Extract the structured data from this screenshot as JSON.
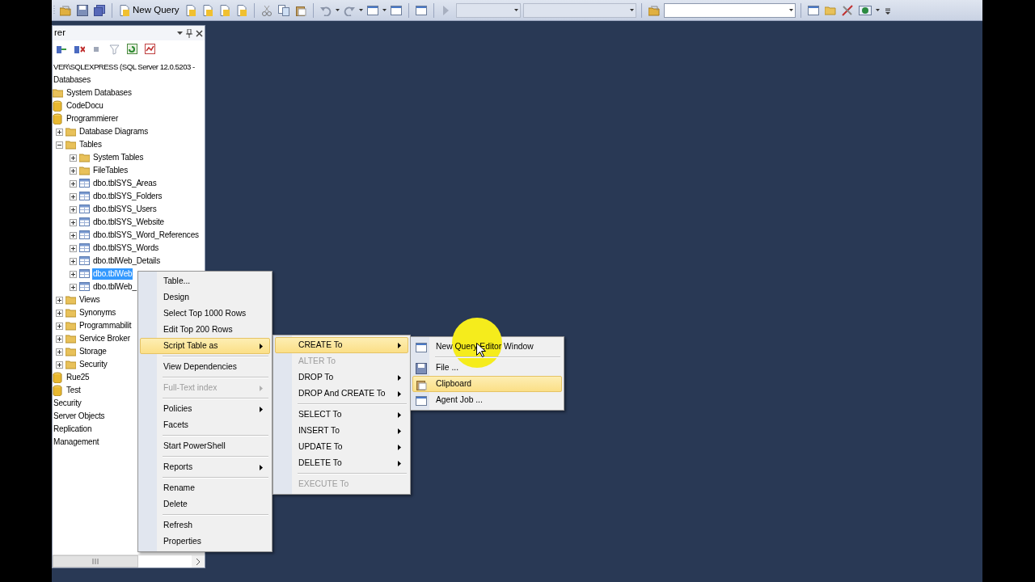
{
  "toolbar": {
    "new_query": "New Query"
  },
  "object_explorer": {
    "title": "rer",
    "tree": [
      {
        "label": "VER\\SQLEXPRESS (SQL Server 12.0.5203 -",
        "selected": false,
        "children": [
          {
            "label": "Databases",
            "selected": false,
            "children": [
              {
                "label": "System Databases",
                "kind": "folder",
                "selected": false
              },
              {
                "label": "CodeDocu",
                "kind": "database",
                "selected": false
              },
              {
                "label": "Programmierer",
                "kind": "database",
                "selected": false,
                "children": [
                  {
                    "label": "Database Diagrams",
                    "kind": "folder",
                    "selected": false,
                    "expanded": false
                  },
                  {
                    "label": "Tables",
                    "kind": "folder",
                    "selected": false,
                    "expanded": true,
                    "children": [
                      {
                        "label": "System Tables",
                        "kind": "folder",
                        "selected": false,
                        "expanded": false
                      },
                      {
                        "label": "FileTables",
                        "kind": "folder",
                        "selected": false,
                        "expanded": false
                      },
                      {
                        "label": "dbo.tblSYS_Areas",
                        "kind": "table",
                        "selected": false,
                        "expanded": false
                      },
                      {
                        "label": "dbo.tblSYS_Folders",
                        "kind": "table",
                        "selected": false,
                        "expanded": false
                      },
                      {
                        "label": "dbo.tblSYS_Users",
                        "kind": "table",
                        "selected": false,
                        "expanded": false
                      },
                      {
                        "label": "dbo.tblSYS_Website",
                        "kind": "table",
                        "selected": false,
                        "expanded": false
                      },
                      {
                        "label": "dbo.tblSYS_Word_References",
                        "kind": "table",
                        "selected": false,
                        "expanded": false
                      },
                      {
                        "label": "dbo.tblSYS_Words",
                        "kind": "table",
                        "selected": false,
                        "expanded": false
                      },
                      {
                        "label": "dbo.tblWeb_Details",
                        "kind": "table",
                        "selected": false,
                        "expanded": false
                      },
                      {
                        "label": "dbo.tblWeb",
                        "kind": "table",
                        "selected": true,
                        "expanded": false
                      },
                      {
                        "label": "dbo.tblWeb_",
                        "kind": "table",
                        "selected": false,
                        "expanded": false
                      }
                    ]
                  },
                  {
                    "label": "Views",
                    "kind": "folder",
                    "selected": false,
                    "expanded": false
                  },
                  {
                    "label": "Synonyms",
                    "kind": "folder",
                    "selected": false,
                    "expanded": false
                  },
                  {
                    "label": "Programmabilit",
                    "kind": "folder",
                    "selected": false,
                    "expanded": false
                  },
                  {
                    "label": "Service Broker",
                    "kind": "folder",
                    "selected": false,
                    "expanded": false
                  },
                  {
                    "label": "Storage",
                    "kind": "folder",
                    "selected": false,
                    "expanded": false
                  },
                  {
                    "label": "Security",
                    "kind": "folder",
                    "selected": false,
                    "expanded": false
                  }
                ]
              },
              {
                "label": "Rue25",
                "kind": "database",
                "selected": false
              },
              {
                "label": "Test",
                "kind": "database",
                "selected": false
              }
            ]
          },
          {
            "label": "Security",
            "selected": false
          },
          {
            "label": "Server Objects",
            "selected": false
          },
          {
            "label": "Replication",
            "selected": false
          },
          {
            "label": "Management",
            "selected": false
          }
        ]
      }
    ]
  },
  "context_menu": {
    "groups": [
      [
        {
          "label": "Table...",
          "selected": false,
          "disabled": false,
          "submenu": false
        },
        {
          "label": "Design",
          "selected": false,
          "disabled": false,
          "submenu": false
        },
        {
          "label": "Select Top 1000 Rows",
          "selected": false,
          "disabled": false,
          "submenu": false
        },
        {
          "label": "Edit Top 200 Rows",
          "selected": false,
          "disabled": false,
          "submenu": false
        },
        {
          "label": "Script Table as",
          "selected": true,
          "disabled": false,
          "submenu": true
        }
      ],
      [
        {
          "label": "View Dependencies",
          "selected": false,
          "disabled": false,
          "submenu": false
        }
      ],
      [
        {
          "label": "Full-Text index",
          "selected": false,
          "disabled": true,
          "submenu": true
        }
      ],
      [
        {
          "label": "Policies",
          "selected": false,
          "disabled": false,
          "submenu": true
        },
        {
          "label": "Facets",
          "selected": false,
          "disabled": false,
          "submenu": false
        }
      ],
      [
        {
          "label": "Start PowerShell",
          "selected": false,
          "disabled": false,
          "submenu": false
        }
      ],
      [
        {
          "label": "Reports",
          "selected": false,
          "disabled": false,
          "submenu": true
        }
      ],
      [
        {
          "label": "Rename",
          "selected": false,
          "disabled": false,
          "submenu": false
        },
        {
          "label": "Delete",
          "selected": false,
          "disabled": false,
          "submenu": false
        }
      ],
      [
        {
          "label": "Refresh",
          "selected": false,
          "disabled": false,
          "submenu": false
        },
        {
          "label": "Properties",
          "selected": false,
          "disabled": false,
          "submenu": false
        }
      ]
    ]
  },
  "script_submenu": {
    "groups": [
      [
        {
          "label": "CREATE To",
          "selected": true,
          "disabled": false,
          "submenu": true
        },
        {
          "label": "ALTER To",
          "selected": false,
          "disabled": true,
          "submenu": false
        },
        {
          "label": "DROP To",
          "selected": false,
          "disabled": false,
          "submenu": true
        },
        {
          "label": "DROP And CREATE To",
          "selected": false,
          "disabled": false,
          "submenu": true
        }
      ],
      [
        {
          "label": "SELECT To",
          "selected": false,
          "disabled": false,
          "submenu": true
        },
        {
          "label": "INSERT To",
          "selected": false,
          "disabled": false,
          "submenu": true
        },
        {
          "label": "UPDATE To",
          "selected": false,
          "disabled": false,
          "submenu": true
        },
        {
          "label": "DELETE To",
          "selected": false,
          "disabled": false,
          "submenu": true
        }
      ],
      [
        {
          "label": "EXECUTE To",
          "selected": false,
          "disabled": true,
          "submenu": false
        }
      ]
    ]
  },
  "create_submenu": {
    "groups": [
      [
        {
          "label": "New Query Editor Window",
          "selected": false,
          "disabled": false,
          "submenu": false
        }
      ],
      [
        {
          "label": "File ...",
          "selected": false,
          "disabled": false,
          "submenu": false
        },
        {
          "label": "Clipboard",
          "selected": true,
          "disabled": false,
          "submenu": false
        },
        {
          "label": "Agent Job ...",
          "selected": false,
          "disabled": false,
          "submenu": false
        }
      ]
    ]
  }
}
